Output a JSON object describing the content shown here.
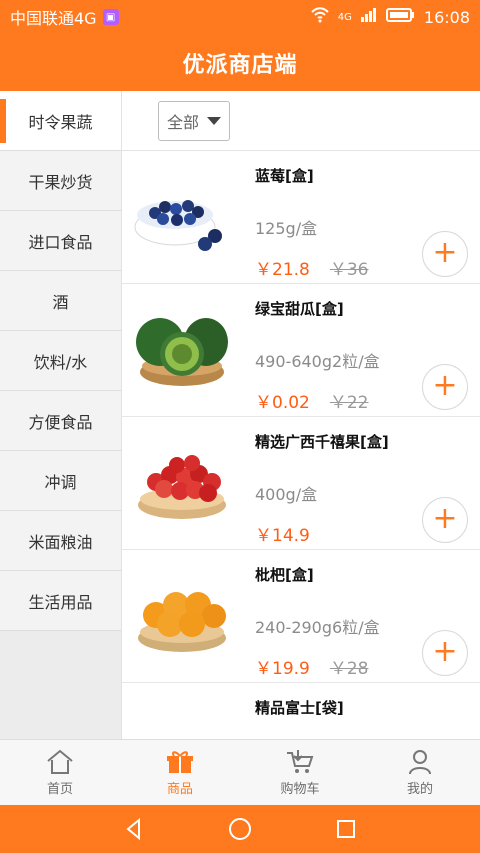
{
  "status_bar": {
    "carrier": "中国联通4G",
    "network": "4G",
    "time": "16:08",
    "colors": {
      "background": "#ff7a1f"
    }
  },
  "header": {
    "title": "优派商店端"
  },
  "sidebar": {
    "items": [
      {
        "label": "时令果蔬",
        "active": true
      },
      {
        "label": "干果炒货",
        "active": false
      },
      {
        "label": "进口食品",
        "active": false
      },
      {
        "label": "酒",
        "active": false
      },
      {
        "label": "饮料/水",
        "active": false
      },
      {
        "label": "方便食品",
        "active": false
      },
      {
        "label": "冲调",
        "active": false
      },
      {
        "label": "米面粮油",
        "active": false
      },
      {
        "label": "生活用品",
        "active": false
      }
    ]
  },
  "filter": {
    "selected": "全部"
  },
  "products": [
    {
      "name": "蓝莓[盒]",
      "spec": "125g/盒",
      "price": "￥21.8",
      "old_price": "￥36",
      "image": "blueberry-bowl-icon"
    },
    {
      "name": "绿宝甜瓜[盒]",
      "spec": "490-640g2粒/盒",
      "price": "￥0.02",
      "old_price": "￥22",
      "image": "green-melon-icon"
    },
    {
      "name": "精选广西千禧果[盒]",
      "spec": "400g/盒",
      "price": "￥14.9",
      "old_price": "",
      "image": "cherry-tomato-basket-icon"
    },
    {
      "name": "枇杷[盒]",
      "spec": "240-290g6粒/盒",
      "price": "￥19.9",
      "old_price": "￥28",
      "image": "loquat-basket-icon"
    },
    {
      "name": "精品富士[袋]",
      "spec": "",
      "price": "",
      "old_price": "",
      "image": "apple-bag-icon"
    }
  ],
  "tabbar": {
    "items": [
      {
        "label": "首页",
        "icon": "home-icon",
        "active": false
      },
      {
        "label": "商品",
        "icon": "gift-box-icon",
        "active": true
      },
      {
        "label": "购物车",
        "icon": "cart-icon",
        "active": false
      },
      {
        "label": "我的",
        "icon": "user-icon",
        "active": false
      }
    ]
  },
  "system_nav": {
    "back": "back-icon",
    "home": "home-circle-icon",
    "recents": "recents-icon"
  },
  "theme": {
    "accent": "#ff7a1f",
    "price_color": "#ff5d14"
  }
}
